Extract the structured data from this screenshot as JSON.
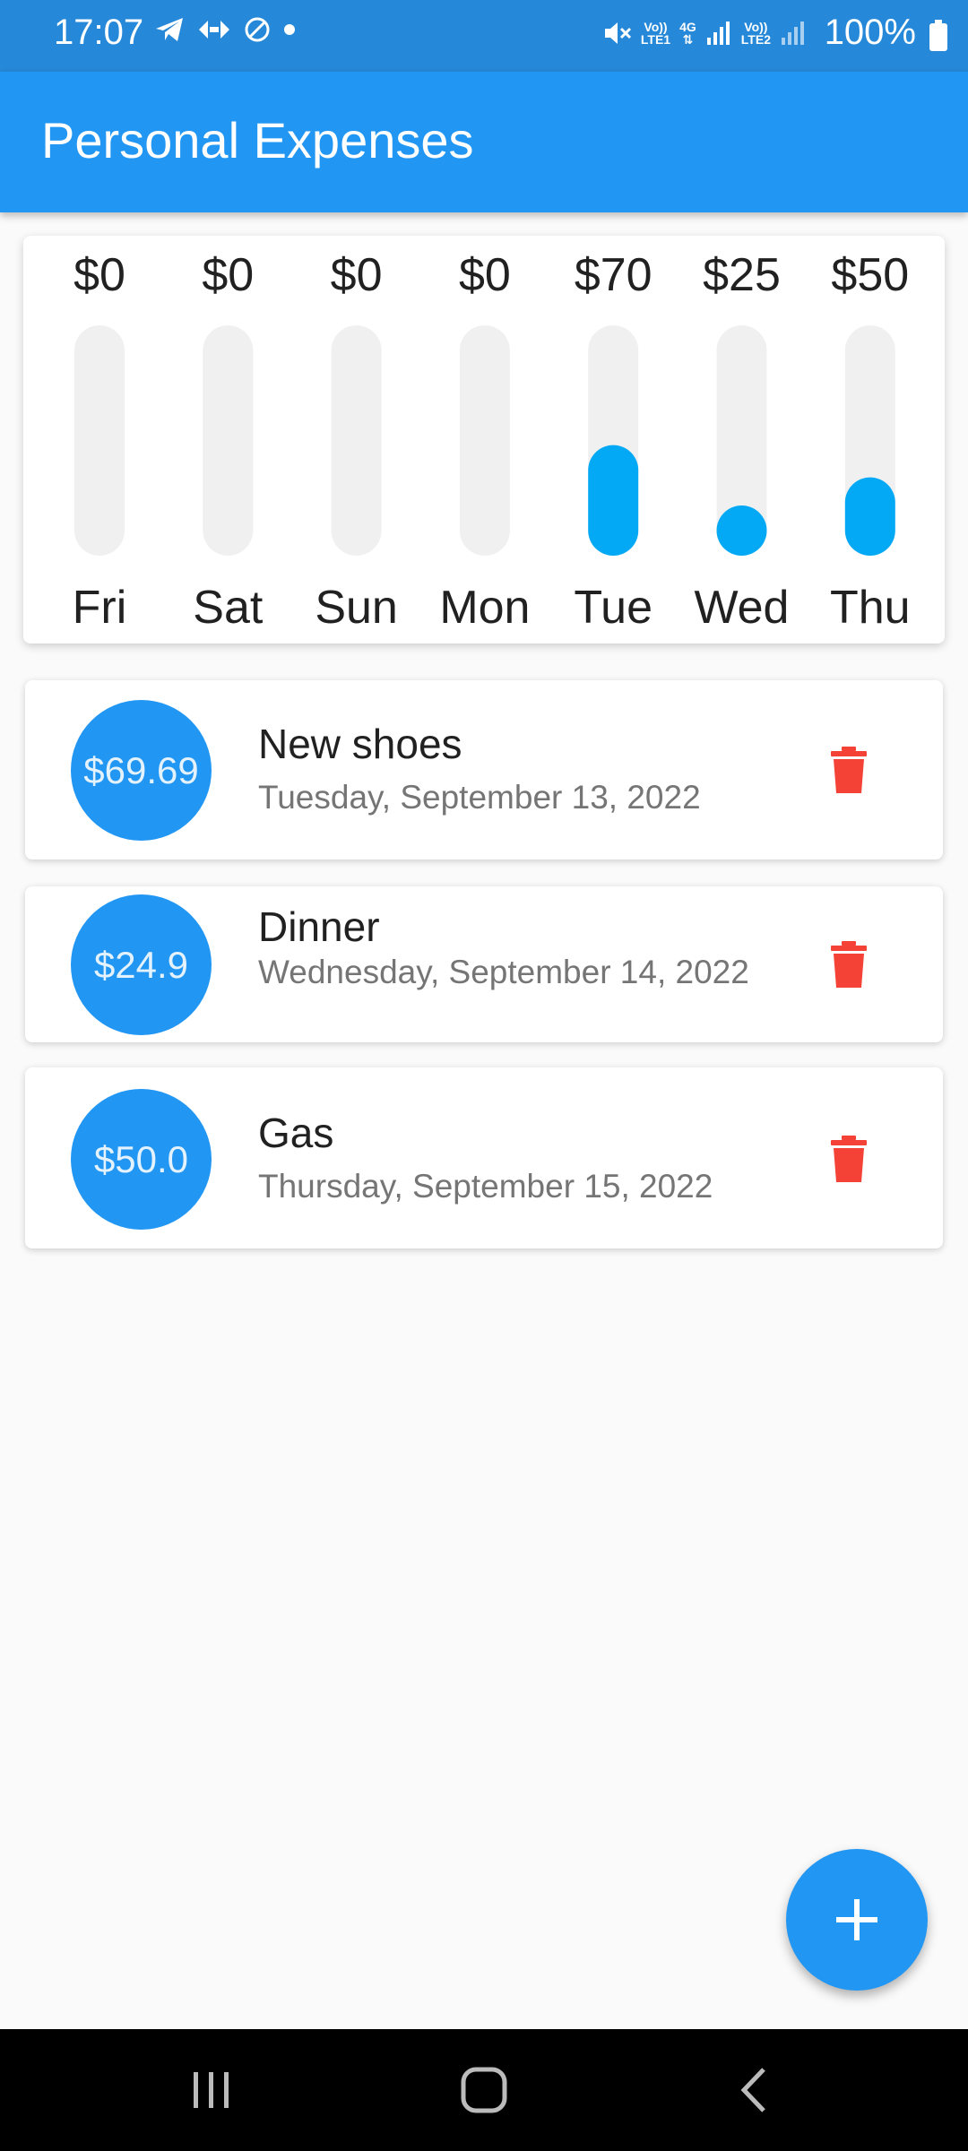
{
  "status_bar": {
    "time": "17:07",
    "battery": "100%",
    "sim1_label": "LTE1",
    "sim2_label": "LTE2",
    "network": "4G",
    "volte": "Vo))"
  },
  "app_bar": {
    "title": "Personal Expenses"
  },
  "chart_data": {
    "type": "bar",
    "categories": [
      "Fri",
      "Sat",
      "Sun",
      "Mon",
      "Tue",
      "Wed",
      "Thu"
    ],
    "values": [
      0,
      0,
      0,
      0,
      70,
      25,
      50
    ],
    "value_labels": [
      "$0",
      "$0",
      "$0",
      "$0",
      "$70",
      "$25",
      "$50"
    ],
    "fill_fraction": [
      0,
      0,
      0,
      0,
      0.48,
      0.17,
      0.34
    ],
    "colors": {
      "bar": "#03a9f4",
      "track": "#f0f0f0"
    }
  },
  "transactions": [
    {
      "amount": "$69.69",
      "title": "New shoes",
      "date": "Tuesday, September 13, 2022"
    },
    {
      "amount": "$24.9",
      "title": "Dinner",
      "date": "Wednesday, September 14, 2022"
    },
    {
      "amount": "$50.0",
      "title": "Gas",
      "date": "Thursday, September 15, 2022"
    }
  ],
  "colors": {
    "primary": "#2196f3",
    "delete": "#f44336",
    "background": "#fafafa"
  },
  "icons": {
    "delete": "trash-icon",
    "fab": "plus-icon"
  }
}
